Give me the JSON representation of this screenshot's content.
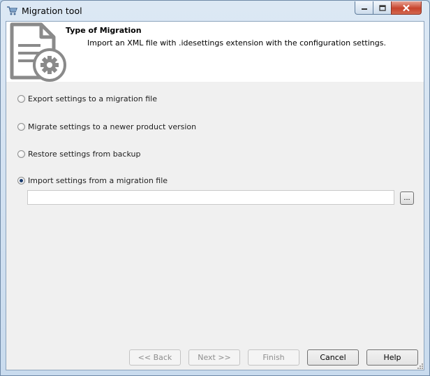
{
  "window": {
    "title": "Migration tool",
    "app_icon": "cart-icon"
  },
  "header": {
    "title": "Type of Migration",
    "description": "Import an XML file with .idesettings extension with the configuration settings.",
    "icon": "document-gear-icon"
  },
  "options": [
    {
      "label": "Export settings to a migration file",
      "checked": false
    },
    {
      "label": "Migrate settings to a newer product version",
      "checked": false
    },
    {
      "label": "Restore settings from backup",
      "checked": false
    },
    {
      "label": "Import settings from a migration file",
      "checked": true
    }
  ],
  "file_input": {
    "value": "",
    "browse_label": "..."
  },
  "buttons": {
    "back": "<< Back",
    "next": "Next >>",
    "finish": "Finish",
    "cancel": "Cancel",
    "help": "Help"
  }
}
